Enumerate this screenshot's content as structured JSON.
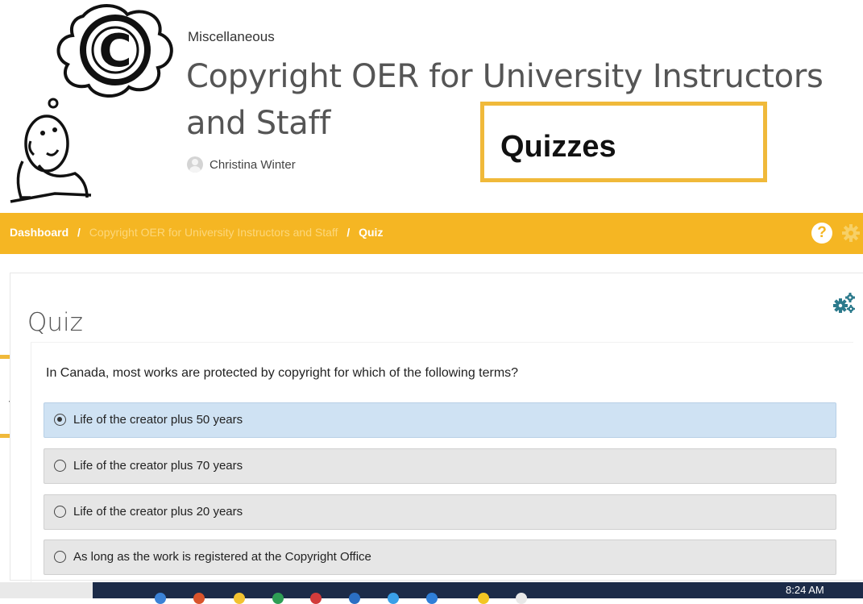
{
  "header": {
    "category": "Miscellaneous",
    "course_title": "Copyright OER for University Instructors and Staff",
    "author": "Christina Winter",
    "illustration_icon": "copyright-thought-bubble-icon"
  },
  "callouts": {
    "quizzes": "Quizzes",
    "left_partial": "s"
  },
  "breadcrumb": {
    "items": [
      "Dashboard",
      "Copyright OER for University Instructors and Staff",
      "Quiz"
    ],
    "separator": "/"
  },
  "toolbar": {
    "help_glyph": "?"
  },
  "quiz": {
    "heading": "Quiz",
    "question": "In Canada, most works are protected by copyright for which of the following terms?",
    "options": [
      {
        "label": "Life of the creator plus 50 years",
        "selected": true
      },
      {
        "label": "Life of the creator plus 70 years",
        "selected": false
      },
      {
        "label": "Life of the creator plus 20 years",
        "selected": false
      },
      {
        "label": "As long as the work is registered at the Copyright Office",
        "selected": false
      }
    ]
  },
  "taskbar": {
    "clock": "8:24 AM"
  },
  "colors": {
    "accent": "#f5b623",
    "callout_border": "#f0b93a",
    "selected_option": "#cfe2f3",
    "settings_icon": "#2c7a8c",
    "taskbar": "#1c2b48"
  }
}
